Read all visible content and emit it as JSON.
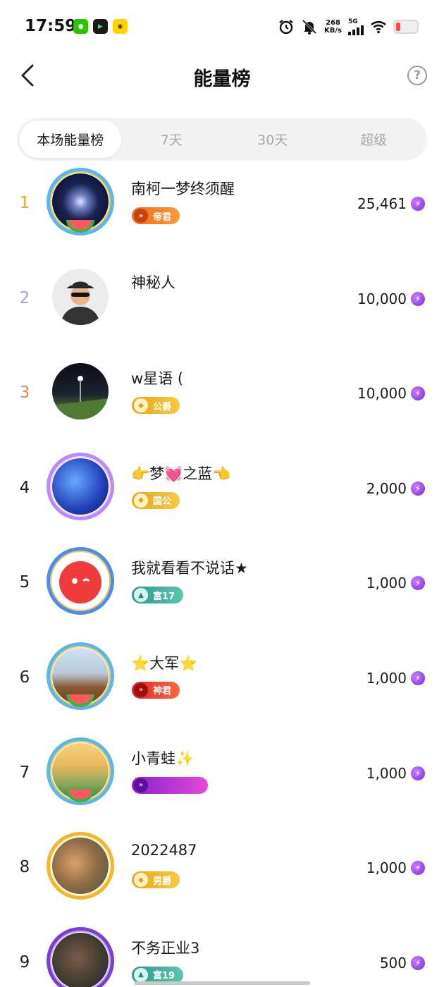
{
  "status_bar": {
    "time": "17:59",
    "speed_value": "268",
    "speed_unit": "KB/s",
    "network": "5G",
    "apps": [
      "wechat-icon",
      "video-app-icon",
      "mini-app-icon"
    ],
    "battery_color": "#ff4d4f"
  },
  "header": {
    "title": "能量榜",
    "back_icon": "chevron-left-icon",
    "help_icon": "question-circle-icon",
    "help_symbol": "?"
  },
  "tabs": [
    {
      "label": "本场能量榜",
      "active": true
    },
    {
      "label": "7天",
      "active": false
    },
    {
      "label": "30天",
      "active": false
    },
    {
      "label": "超级",
      "active": false
    }
  ],
  "ranking": [
    {
      "rank": "1",
      "name": "南柯一梦终须醒",
      "badge": "帝君",
      "badge_style": "orange",
      "score": "25,461"
    },
    {
      "rank": "2",
      "name": "神秘人",
      "badge": "",
      "badge_style": "",
      "score": "10,000"
    },
    {
      "rank": "3",
      "name": "w星语 (",
      "badge": "公爵",
      "badge_style": "gold",
      "score": "10,000"
    },
    {
      "rank": "4",
      "name": "👉梦💓之蓝👈",
      "badge": "国公",
      "badge_style": "gold",
      "score": "2,000"
    },
    {
      "rank": "5",
      "name": "我就看看不说话★",
      "badge": "富17",
      "badge_style": "teal",
      "score": "1,000"
    },
    {
      "rank": "6",
      "name": "⭐大军⭐",
      "badge": "神君",
      "badge_style": "red",
      "score": "1,000"
    },
    {
      "rank": "7",
      "name": "小青蛙✨",
      "badge": "",
      "badge_style": "purple",
      "score": "1,000"
    },
    {
      "rank": "8",
      "name": "2022487",
      "badge": "男爵",
      "badge_style": "gold",
      "score": "1,000"
    },
    {
      "rank": "9",
      "name": "不务正业3",
      "badge": "富19",
      "badge_style": "teal",
      "score": "500"
    }
  ],
  "score_icon": "energy-lightning-icon",
  "accent_colors": {
    "rank1": "#f5a623",
    "rank2": "#9aa8e6",
    "rank3": "#d99050",
    "energy": "#7b2cd6"
  }
}
